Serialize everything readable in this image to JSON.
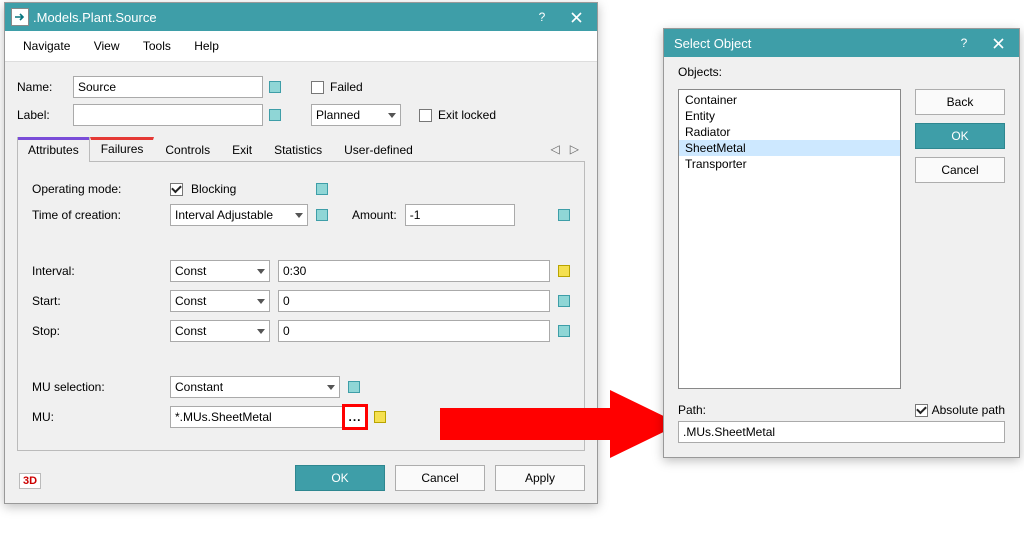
{
  "source_window": {
    "title": ".Models.Plant.Source",
    "menu": {
      "navigate": "Navigate",
      "view": "View",
      "tools": "Tools",
      "help": "Help"
    },
    "labels": {
      "name": "Name:",
      "label": "Label:",
      "failed": "Failed",
      "planned": "Planned",
      "exit_locked": "Exit locked"
    },
    "name_value": "Source",
    "label_value": "",
    "tabs": {
      "attributes": "Attributes",
      "failures": "Failures",
      "controls": "Controls",
      "exit": "Exit",
      "statistics": "Statistics",
      "userdef": "User-defined"
    },
    "attributes": {
      "operating_mode_lbl": "Operating mode:",
      "blocking_lbl": "Blocking",
      "time_of_creation_lbl": "Time of creation:",
      "time_of_creation_val": "Interval Adjustable",
      "amount_lbl": "Amount:",
      "amount_val": "-1",
      "interval_lbl": "Interval:",
      "start_lbl": "Start:",
      "stop_lbl": "Stop:",
      "const_lbl": "Const",
      "interval_val": "0:30",
      "start_val": "0",
      "stop_val": "0",
      "mu_selection_lbl": "MU selection:",
      "mu_selection_val": "Constant",
      "mu_lbl": "MU:",
      "mu_val": "*.MUs.SheetMetal",
      "ellipsis": "..."
    },
    "buttons": {
      "ok": "OK",
      "cancel": "Cancel",
      "apply": "Apply"
    },
    "icon_3d": "3D"
  },
  "select_object_window": {
    "title": "Select Object",
    "objects_lbl": "Objects:",
    "items": [
      "Container",
      "Entity",
      "Radiator",
      "SheetMetal",
      "Transporter"
    ],
    "selected_index": 3,
    "buttons": {
      "back": "Back",
      "ok": "OK",
      "cancel": "Cancel"
    },
    "absolute_path_lbl": "Absolute path",
    "path_lbl": "Path:",
    "path_val": ".MUs.SheetMetal"
  }
}
